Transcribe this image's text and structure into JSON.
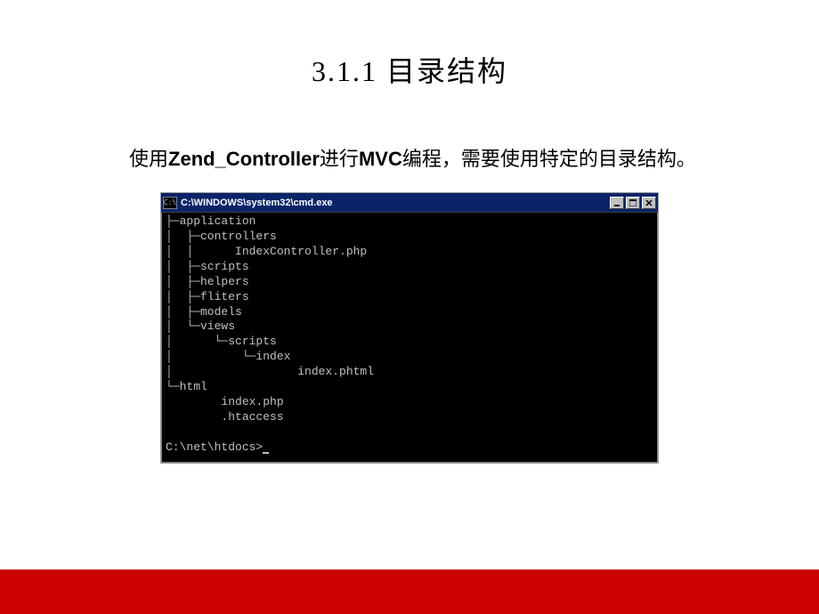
{
  "title": "3.1.1  目录结构",
  "body_prefix": "使用",
  "body_bold1": "Zend_Controller",
  "body_mid": "进行",
  "body_bold2": "MVC",
  "body_suffix": "编程，需要使用特定的目录结构。",
  "cmd": {
    "icon_text": "C:\\",
    "title": "C:\\WINDOWS\\system32\\cmd.exe",
    "tree_lines": [
      "├─application",
      "│  ├─controllers",
      "│  │      IndexController.php",
      "│  ├─scripts",
      "│  ├─helpers",
      "│  ├─fliters",
      "│  ├─models",
      "│  └─views",
      "│      └─scripts",
      "│          └─index",
      "│                  index.phtml",
      "└─html",
      "        index.php",
      "        .htaccess",
      "",
      "C:\\net\\htdocs>"
    ]
  }
}
